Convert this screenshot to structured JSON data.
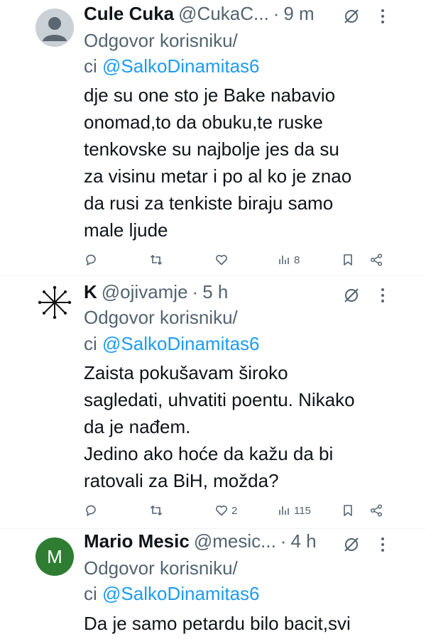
{
  "tweets": [
    {
      "avatar": "default-avatar",
      "name": "Cule Cuka",
      "handle": "@CukaC...",
      "time": "9 m",
      "reply_prefix": "Odgovor korisniku/",
      "reply_prefix2": "ci",
      "reply_mention": "@SalkoDinamitas6",
      "body": [
        "dje su one sto je Bake nabavio",
        "onomad,to da obuku,te ruske",
        "tenkovske su najbolje jes da su",
        "za visinu metar i po al ko je znao",
        "da rusi za tenkiste biraju samo",
        "male ljude"
      ],
      "views": "8",
      "likes": ""
    },
    {
      "avatar": "star-avatar",
      "name": "K",
      "handle": "@ojivamje",
      "time": "5 h",
      "reply_prefix": "Odgovor korisniku/",
      "reply_prefix2": "ci",
      "reply_mention": "@SalkoDinamitas6",
      "body": [
        "Zaista pokušavam široko",
        "sagledati, uhvatiti poentu. Nikako",
        "da je nađem.",
        "Jedino ako hoće da kažu da bi",
        "ratovali za BiH, možda?"
      ],
      "views": "115",
      "likes": "2"
    },
    {
      "avatar": "M",
      "name": "Mario Mesic",
      "handle": "@mesic...",
      "time": "4 h",
      "reply_prefix": "Odgovor korisniku/",
      "reply_prefix2": "ci",
      "reply_mention": "@SalkoDinamitas6",
      "body": [
        "Da je samo petardu bilo bacit,svi"
      ]
    }
  ],
  "colors": {
    "mention": "#1d9bf0",
    "muted": "#536471",
    "text": "#0f1419",
    "avatar_m": "#2e7d32"
  },
  "icons": [
    "reply-icon",
    "retweet-icon",
    "like-icon",
    "views-icon",
    "bookmark-icon",
    "share-icon",
    "grok-icon",
    "more-icon"
  ]
}
